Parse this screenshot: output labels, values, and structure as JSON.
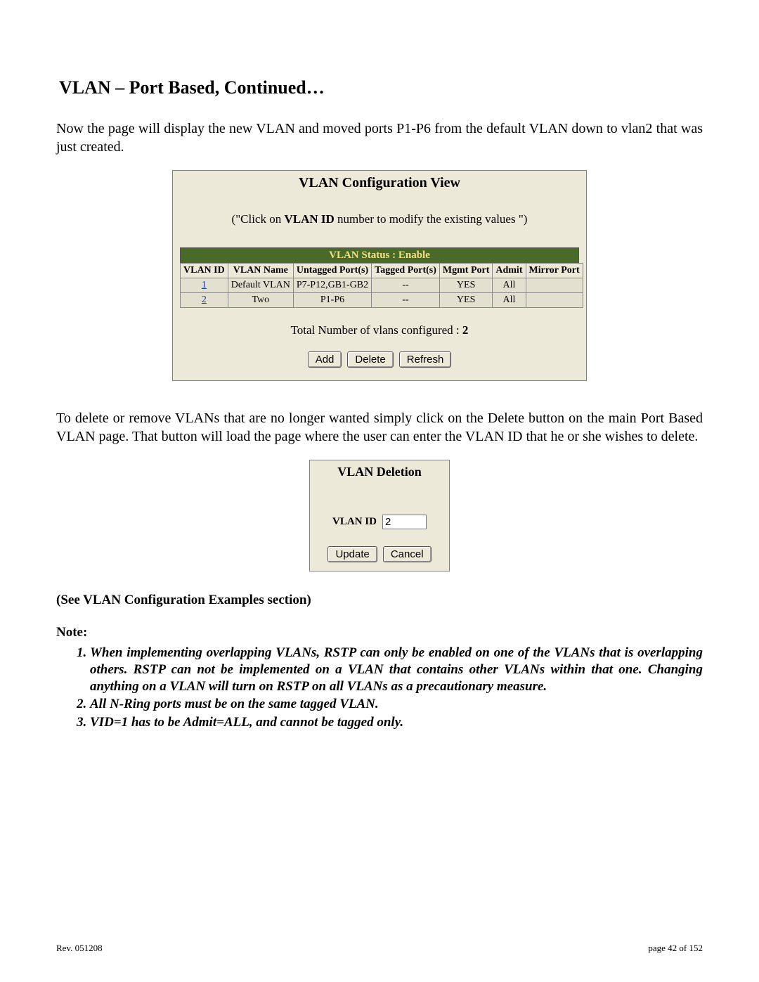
{
  "header": {
    "title": "VLAN – Port Based, Continued…"
  },
  "intro_paragraph": "Now the page will display the new VLAN and moved ports P1-P6 from the default VLAN down to vlan2 that was just created.",
  "config_panel": {
    "title": "VLAN Configuration View",
    "hint_prefix": "(\"Click on ",
    "hint_bold": "VLAN ID",
    "hint_suffix": " number to modify the existing values \")",
    "status_bar": "VLAN Status   :   Enable",
    "columns": [
      "VLAN ID",
      "VLAN Name",
      "Untagged Port(s)",
      "Tagged Port(s)",
      "Mgmt Port",
      "Admit",
      "Mirror Port"
    ],
    "rows": [
      {
        "id": "1",
        "name": "Default VLAN",
        "untagged": "P7-P12,GB1-GB2",
        "tagged": "--",
        "mgmt": "YES",
        "admit": "All",
        "mirror": " "
      },
      {
        "id": "2",
        "name": "Two",
        "untagged": "P1-P6",
        "tagged": "--",
        "mgmt": "YES",
        "admit": "All",
        "mirror": " "
      }
    ],
    "total_prefix": "Total Number of vlans configured : ",
    "total_value": "2",
    "buttons": {
      "add": "Add",
      "delete": "Delete",
      "refresh": "Refresh"
    }
  },
  "delete_paragraph": "To delete or remove VLANs that are no longer wanted simply click on the Delete button on the main Port Based VLAN page.  That button will load the page where the user can enter the VLAN ID that he or she wishes to delete.",
  "delete_panel": {
    "title": "VLAN Deletion",
    "label": "VLAN ID",
    "value": "2",
    "buttons": {
      "update": "Update",
      "cancel": "Cancel"
    }
  },
  "see_examples": "(See VLAN Configuration Examples section)",
  "note_label": "Note:",
  "notes": [
    "When implementing overlapping VLANs, RSTP can only be enabled on one of the VLANs that is overlapping others.  RSTP can not be implemented on a VLAN that contains other VLANs within that one.  Changing anything on a VLAN will turn on RSTP on all VLANs as a precautionary measure.",
    "All N-Ring ports must be on the same tagged VLAN.",
    "VID=1 has to be Admit=ALL, and cannot be tagged only."
  ],
  "footer": {
    "left": "Rev.  051208",
    "right": "page 42 of 152"
  }
}
